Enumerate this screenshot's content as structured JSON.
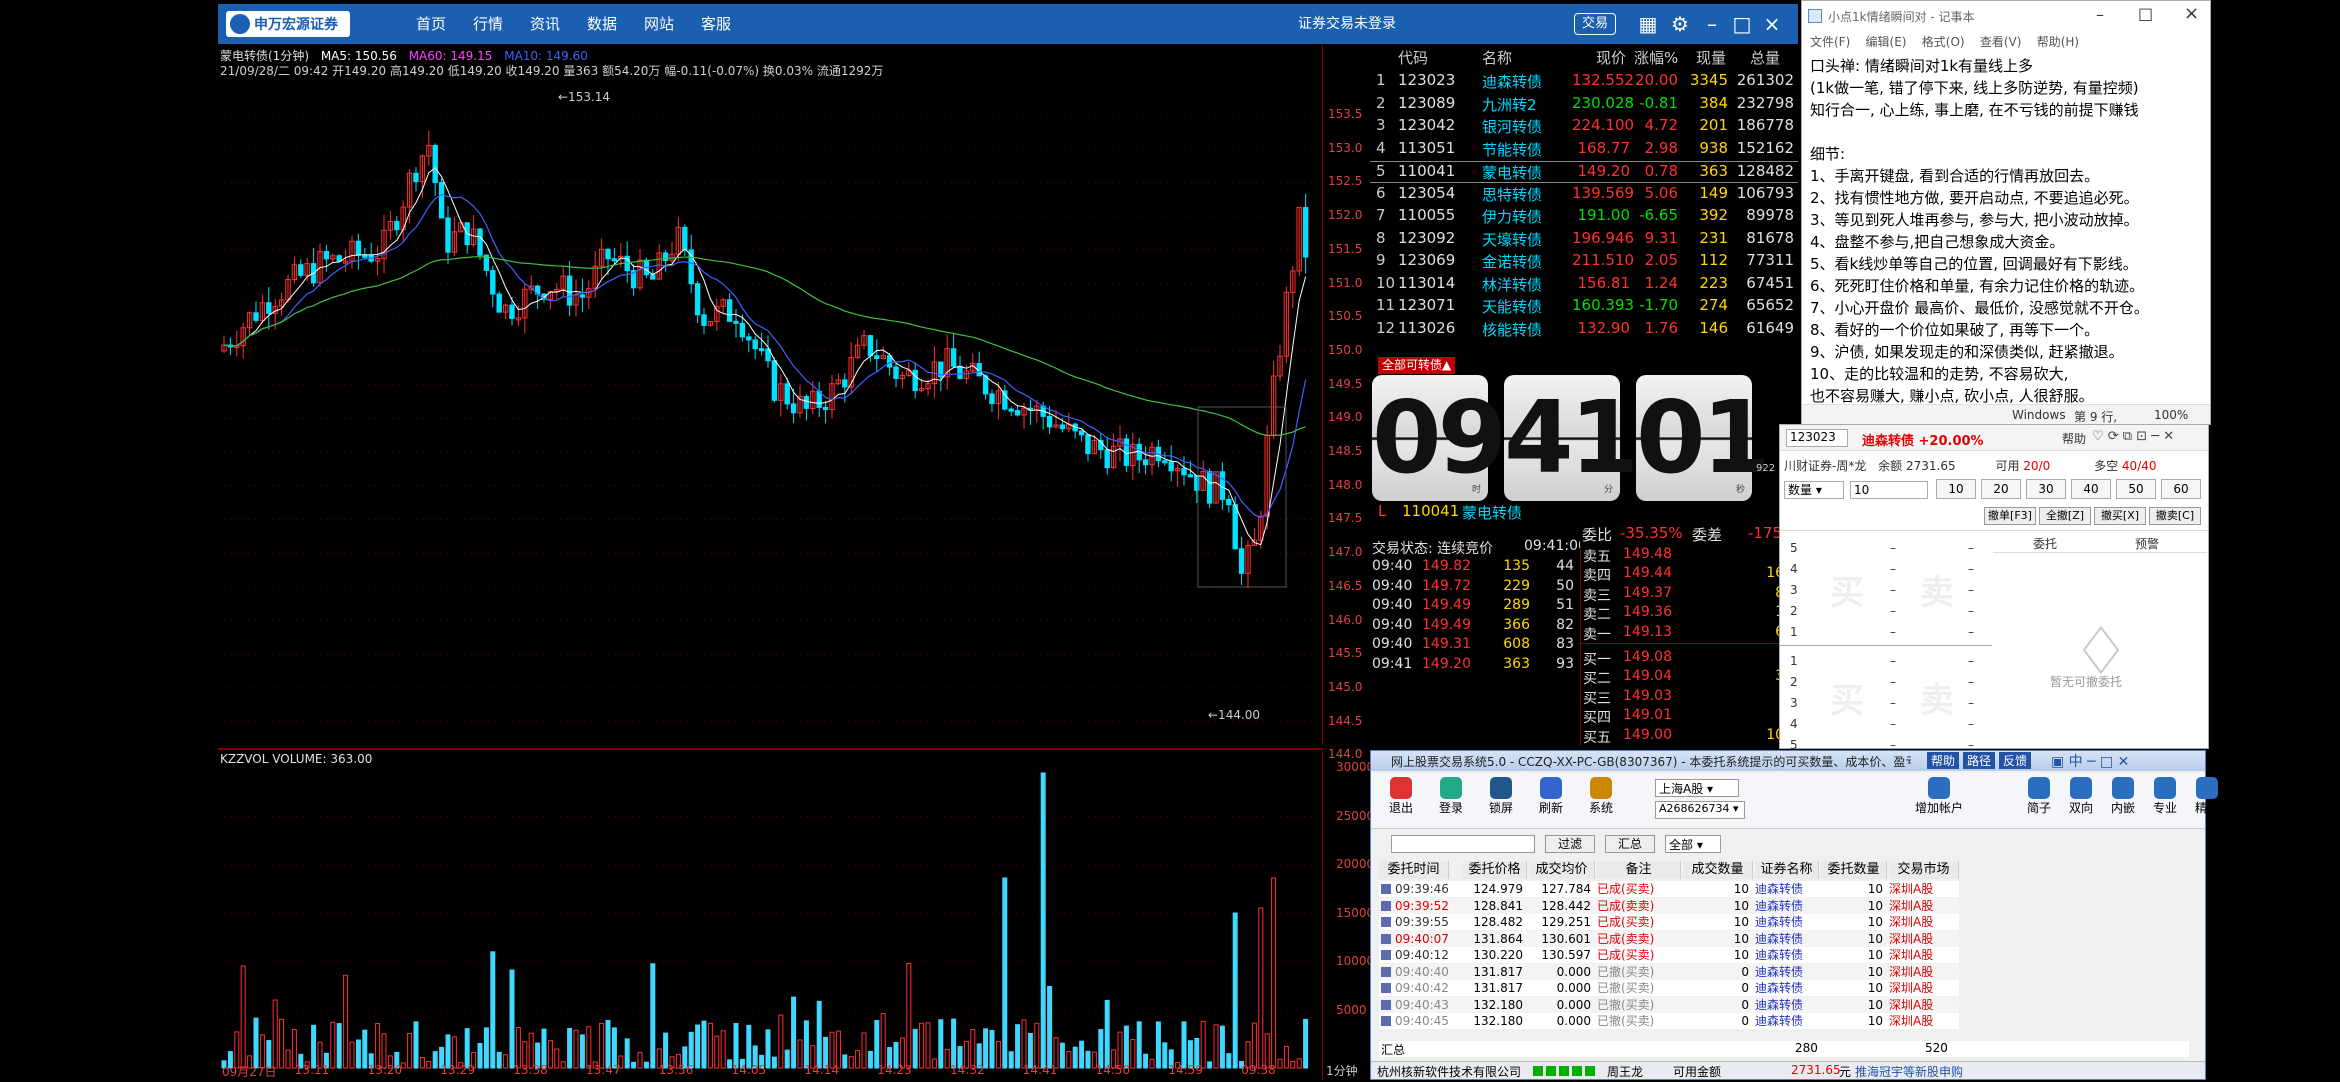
{
  "app": {
    "brand": "申万宏源证券",
    "nav": [
      "首页",
      "行情",
      "资讯",
      "数据",
      "网站",
      "客服"
    ],
    "status": "证券交易未登录",
    "trade_btn": "交易"
  },
  "kline": {
    "title": "蒙电转债(1分钟)",
    "ma5": "MA5: 150.56",
    "ma60": "MA60: 149.15",
    "ma10": "MA10: 149.60",
    "info": "21/09/28/二 09:42 开149.20 高149.20 低149.20 收149.20 量363 额54.20万 幅-0.11(-0.07%) 换0.03% 流通1292万",
    "high_label": "153.14",
    "low_label": "144.00",
    "yticks": [
      "153.5",
      "153.0",
      "152.5",
      "152.0",
      "151.5",
      "151.0",
      "150.5",
      "150.0",
      "149.5",
      "149.0",
      "148.5",
      "148.0",
      "147.5",
      "147.0",
      "146.5",
      "146.0",
      "145.5",
      "145.0",
      "144.5",
      "144.0"
    ]
  },
  "volume": {
    "title": "KZZVOL VOLUME: 363.00",
    "yticks": [
      "30000",
      "25000",
      "20000",
      "15000",
      "10000",
      "5000"
    ],
    "xticks": [
      "09月27日",
      "13:11",
      "13:20",
      "13:29",
      "13:38",
      "13:47",
      "13:56",
      "14:05",
      "14:14",
      "14:23",
      "14:32",
      "14:41",
      "14:50",
      "14:59",
      "09:38"
    ],
    "period": "1分钟"
  },
  "quote_table": {
    "headers": [
      "代码",
      "名称",
      "现价",
      "涨幅%",
      "现量",
      "总量"
    ],
    "rows": [
      [
        "1",
        "123023",
        "迪森转债",
        "132.552",
        "20.00",
        "3345",
        "261302"
      ],
      [
        "2",
        "123089",
        "九洲转2",
        "230.028",
        "-0.81",
        "384",
        "232798"
      ],
      [
        "3",
        "123042",
        "银河转债",
        "224.100",
        "4.72",
        "201",
        "186778"
      ],
      [
        "4",
        "113051",
        "节能转债",
        "168.77",
        "2.98",
        "938",
        "152162"
      ],
      [
        "5",
        "110041",
        "蒙电转债",
        "149.20",
        "0.78",
        "363",
        "128482"
      ],
      [
        "6",
        "123054",
        "思特转债",
        "139.569",
        "5.06",
        "149",
        "106793"
      ],
      [
        "7",
        "110055",
        "伊力转债",
        "191.00",
        "-6.65",
        "392",
        "89978"
      ],
      [
        "8",
        "123092",
        "天壕转债",
        "196.946",
        "9.31",
        "231",
        "81678"
      ],
      [
        "9",
        "123069",
        "金诺转债",
        "211.510",
        "2.05",
        "112",
        "77311"
      ],
      [
        "10",
        "113014",
        "林洋转债",
        "156.81",
        "1.24",
        "223",
        "67451"
      ],
      [
        "11",
        "123071",
        "天能转债",
        "160.393",
        "-1.70",
        "274",
        "65652"
      ],
      [
        "12",
        "113026",
        "核能转债",
        "132.90",
        "1.76",
        "146",
        "61649"
      ]
    ]
  },
  "all_convert_label": "全部可转债▲",
  "clock": {
    "h": "09",
    "m": "41",
    "s": "01",
    "h_unit": "时",
    "m_unit": "分",
    "s_unit": "秒",
    "side_num": "922"
  },
  "stock": {
    "prefix": "L",
    "code": "110041",
    "name": "蒙电转债",
    "wb_label": "委比",
    "wb": "-35.35%",
    "wc_label": "委差",
    "wc": "-175"
  },
  "trade_status": {
    "label": "交易状态: 连续竞价",
    "time": "09:41:00"
  },
  "ticks": [
    [
      "09:40",
      "149.82",
      "135",
      "44"
    ],
    [
      "09:40",
      "149.72",
      "229",
      "50"
    ],
    [
      "09:40",
      "149.49",
      "289",
      "51"
    ],
    [
      "09:40",
      "149.49",
      "366",
      "82"
    ],
    [
      "09:40",
      "149.31",
      "608",
      "83"
    ],
    [
      "09:41",
      "149.20",
      "363",
      "93"
    ]
  ],
  "book": [
    [
      "卖五",
      "149.48",
      "5"
    ],
    [
      "卖四",
      "149.44",
      "169"
    ],
    [
      "卖三",
      "149.37",
      "86"
    ],
    [
      "卖二",
      "149.36",
      "13"
    ],
    [
      "卖一",
      "149.13",
      "62"
    ],
    [
      "买一",
      "149.08",
      "4"
    ],
    [
      "买二",
      "149.04",
      "39"
    ],
    [
      "买三",
      "149.03",
      "7"
    ],
    [
      "买四",
      "149.01",
      "2"
    ],
    [
      "买五",
      "149.00",
      "108"
    ]
  ],
  "notepad": {
    "title": "小点1k情绪瞬间对 - 记事本",
    "menu": [
      "文件(F)",
      "编辑(E)",
      "格式(O)",
      "查看(V)",
      "帮助(H)"
    ],
    "lines": [
      "口头禅: 情绪瞬间对1k有量线上多",
      "(1k做一笔, 错了停下来, 线上多防逆势, 有量控频)",
      "知行合一, 心上练, 事上磨, 在不亏钱的前提下赚钱",
      "",
      "细节:",
      "1、手离开键盘, 看到合适的行情再放回去。",
      "2、找有惯性地方做, 要开启动点, 不要追追必死。",
      "3、等见到死人堆再参与, 参与大, 把小波动放掉。",
      "4、盘整不参与,把自己想象成大资金。",
      "5、看k线炒单等自己的位置, 回调最好有下影线。",
      "6、死死盯住价格和单量, 有余力记住价格的轨迹。",
      "7、小心开盘价 最高价、最低价, 没感觉就不开仓。",
      "8、看好的一个价位如果破了, 再等下一个。",
      "9、沪债, 如果发现走的和深债类似, 赶紧撤退。",
      "10、走的比较温和的走势, 不容易砍大,",
      "也不容易赚大, 赚小点, 砍小点, 人很舒服。"
    ],
    "status_os": "Windows",
    "status_line": "第 9 行,",
    "status_zoom": "100%"
  },
  "trade_panel": {
    "code": "123023",
    "name_change": "迪森转债 +20.00%",
    "help": "帮助",
    "account": "川财证券-周*龙",
    "balance": "余额 2731.65",
    "avail_label": "可用",
    "avail": "20/0",
    "ls_label": "多空",
    "ls": "40/40",
    "qty_label": "数量",
    "qty_value": "10",
    "presets": [
      "10",
      "20",
      "30",
      "40",
      "50",
      "60"
    ],
    "actions": [
      "撤单[F3]",
      "全撤[Z]",
      "撤买[X]",
      "撤卖[C]"
    ],
    "tabs": [
      "委托",
      "预警"
    ],
    "ladder_nums": [
      "5",
      "4",
      "3",
      "2",
      "1",
      "1",
      "2",
      "3",
      "4",
      "5"
    ],
    "buy": "买",
    "sell": "卖",
    "empty": "暂无可撤委托"
  },
  "order_window": {
    "title": "网上股票交易系统5.0 - CCZQ-XX-PC-GB(8307367) - 本委托系统提示的可买数量、成本价、盈亏数",
    "title_btns": [
      "帮助",
      "路径",
      "反馈"
    ],
    "toolbar": [
      "退出",
      "登录",
      "锁屏",
      "刷新",
      "系统"
    ],
    "toolbar_right": [
      "增加帐户",
      "简子",
      "双向",
      "内嵌",
      "专业",
      "精简"
    ],
    "market": "上海A股",
    "account": "A268626734",
    "filter_btn": "过滤",
    "summary_btn": "汇总",
    "all_select": "全部",
    "columns": [
      "委托时间",
      "委托价格",
      "成交均价",
      "备注",
      "成交数量",
      "证券名称",
      "委托数量",
      "交易市场"
    ],
    "rows": [
      [
        "09:39:46",
        "124.979",
        "127.784",
        "已成(买卖)",
        "10",
        "迪森转债",
        "10",
        "深圳A股"
      ],
      [
        "09:39:52",
        "128.841",
        "128.442",
        "已成(卖卖)",
        "10",
        "迪森转债",
        "10",
        "深圳A股"
      ],
      [
        "09:39:55",
        "128.482",
        "129.251",
        "已成(买卖)",
        "10",
        "迪森转债",
        "10",
        "深圳A股"
      ],
      [
        "09:40:07",
        "131.864",
        "130.601",
        "已成(卖卖)",
        "10",
        "迪森转债",
        "10",
        "深圳A股"
      ],
      [
        "09:40:12",
        "130.220",
        "130.597",
        "已成(买卖)",
        "10",
        "迪森转债",
        "10",
        "深圳A股"
      ],
      [
        "09:40:40",
        "131.817",
        "0.000",
        "已撤(买卖)",
        "0",
        "迪森转债",
        "10",
        "深圳A股"
      ],
      [
        "09:40:42",
        "131.817",
        "0.000",
        "已撤(买卖)",
        "0",
        "迪森转债",
        "10",
        "深圳A股"
      ],
      [
        "09:40:43",
        "132.180",
        "0.000",
        "已撤(买卖)",
        "0",
        "迪森转债",
        "10",
        "深圳A股"
      ],
      [
        "09:40:45",
        "132.180",
        "0.000",
        "已撤(买卖)",
        "0",
        "迪森转债",
        "10",
        "深圳A股"
      ]
    ],
    "total_label": "汇总",
    "total_qty": "280",
    "total_order": "520",
    "footer_company": "杭州核新软件技术有限公司",
    "footer_user": "周王龙",
    "footer_avail_label": "可用金额",
    "footer_avail": "2731.65",
    "footer_unit": "元",
    "footer_notice": "推海冠宇等新股申购"
  },
  "colors": {
    "up": "#ff3030",
    "down": "#00e000",
    "cyan": "#00d8ff",
    "brand_blue": "#1a5fb0"
  }
}
